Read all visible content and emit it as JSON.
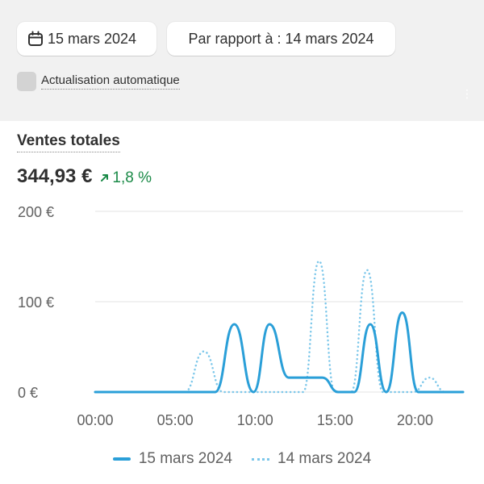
{
  "toolbar": {
    "date_label": "15 mars 2024",
    "compare_label": "Par rapport à : 14 mars 2024",
    "auto_refresh_label": "Actualisation automatique",
    "auto_refresh_checked": false
  },
  "metric": {
    "title": "Ventes totales",
    "value": "344,93 €",
    "delta": "1,8 %",
    "delta_direction": "up",
    "delta_color": "#1a8a47"
  },
  "colors": {
    "current": "#2a9fd8",
    "previous": "#7cc7ea"
  },
  "chart_data": {
    "type": "line",
    "title": "",
    "xlabel": "",
    "ylabel": "",
    "x_ticks": [
      "00:00",
      "05:00",
      "10:00",
      "15:00",
      "20:00"
    ],
    "y_ticks": [
      "0 €",
      "100 €",
      "200 €"
    ],
    "ylim": [
      0,
      200
    ],
    "xlim_hours": [
      0,
      23
    ],
    "grid": true,
    "legend": "bottom",
    "series": [
      {
        "name": "15 mars 2024",
        "style": "solid",
        "points": [
          [
            0,
            0
          ],
          [
            6.5,
            0
          ],
          [
            7.5,
            0
          ],
          [
            8.7,
            75
          ],
          [
            9.9,
            0
          ],
          [
            10.9,
            75
          ],
          [
            12.1,
            16
          ],
          [
            14.2,
            16
          ],
          [
            15.2,
            0
          ],
          [
            16.2,
            0
          ],
          [
            17.2,
            75
          ],
          [
            18.2,
            0
          ],
          [
            19.2,
            88
          ],
          [
            20.2,
            0
          ],
          [
            23,
            0
          ]
        ]
      },
      {
        "name": "14 mars 2024",
        "style": "dotted",
        "points": [
          [
            0,
            0
          ],
          [
            5.6,
            0
          ],
          [
            6.8,
            45
          ],
          [
            8,
            0
          ],
          [
            13,
            0
          ],
          [
            14,
            145
          ],
          [
            15,
            0
          ],
          [
            16,
            0
          ],
          [
            17,
            135
          ],
          [
            18,
            0
          ],
          [
            19.9,
            0
          ],
          [
            20.9,
            16
          ],
          [
            21.9,
            0
          ],
          [
            23,
            0
          ]
        ]
      }
    ]
  }
}
